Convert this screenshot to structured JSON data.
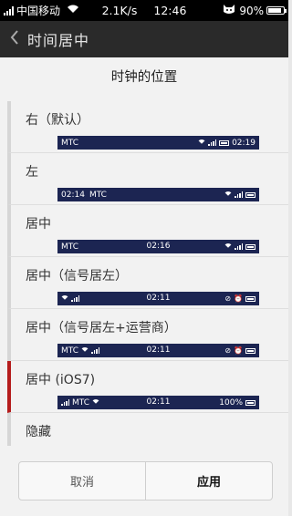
{
  "status_bar": {
    "carrier": "中国移动",
    "speed": "2.1K/s",
    "time": "12:46",
    "battery": "90%",
    "battery_level": 0.9
  },
  "app_bar": {
    "title": "时间居中"
  },
  "dialog": {
    "title": "时钟的位置",
    "options": [
      {
        "label": "右（默认）",
        "preview": {
          "left": "MTC",
          "center": "",
          "right_time": "02:19",
          "left_time": ""
        }
      },
      {
        "label": "左",
        "preview": {
          "left_time": "02:14",
          "left": "MTC",
          "center": "",
          "right_time": ""
        }
      },
      {
        "label": "居中",
        "preview": {
          "left": "MTC",
          "center": "02:16",
          "right_time": "",
          "left_time": ""
        }
      },
      {
        "label": "居中（信号居左）",
        "preview": {
          "left": "",
          "center": "02:11",
          "right_time": "",
          "left_time": ""
        }
      },
      {
        "label": "居中（信号居左+运营商）",
        "preview": {
          "left": "MTC",
          "center": "02:11",
          "right_time": "",
          "left_time": ""
        }
      },
      {
        "label": "居中 (iOS7)",
        "preview": {
          "left": "MTC",
          "center": "02:11",
          "right_pct": "100%",
          "left_time": ""
        }
      },
      {
        "label": "隐藏"
      }
    ],
    "selected_index": 5,
    "cancel_label": "取消",
    "apply_label": "应用"
  },
  "colors": {
    "accent": "#b51c1c",
    "preview_bg": "#1c2552"
  }
}
